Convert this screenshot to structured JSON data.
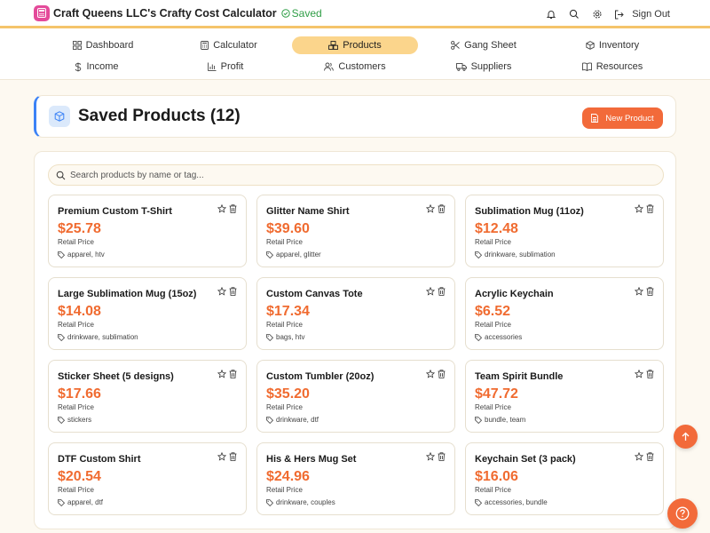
{
  "app": {
    "title": "Craft Queens LLC's Crafty Cost Calculator",
    "saved_label": "Saved",
    "sign_out_label": "Sign Out"
  },
  "colors": {
    "accent": "#f26a3a",
    "price": "#f06b30",
    "saved_green": "#2f9e46",
    "nav_active": "#fbd58c",
    "header_border": "#3b82f6"
  },
  "icons": {
    "logo": "calculator-icon",
    "saved": "check-circle-icon",
    "notifications": "bell-icon",
    "search": "search-icon",
    "settings": "gear-icon",
    "sign_out": "logout-icon"
  },
  "nav": {
    "row1": [
      {
        "label": "Dashboard",
        "icon": "grid-icon",
        "active": false
      },
      {
        "label": "Calculator",
        "icon": "calculator-icon",
        "active": false
      },
      {
        "label": "Products",
        "icon": "boxes-icon",
        "active": true
      },
      {
        "label": "Gang Sheet",
        "icon": "scissors-icon",
        "active": false
      },
      {
        "label": "Inventory",
        "icon": "package-icon",
        "active": false
      }
    ],
    "row2": [
      {
        "label": "Income",
        "icon": "dollar-icon",
        "active": false
      },
      {
        "label": "Profit",
        "icon": "bar-chart-icon",
        "active": false
      },
      {
        "label": "Customers",
        "icon": "users-icon",
        "active": false
      },
      {
        "label": "Suppliers",
        "icon": "truck-icon",
        "active": false
      },
      {
        "label": "Resources",
        "icon": "book-icon",
        "active": false
      }
    ]
  },
  "header": {
    "title": "Saved Products (12)",
    "new_product_label": "New Product"
  },
  "search": {
    "placeholder": "Search products by name or tag..."
  },
  "products": [
    {
      "name": "Premium Custom T-Shirt",
      "price": "$25.78",
      "price_label": "Retail Price",
      "tags": "apparel, htv"
    },
    {
      "name": "Glitter Name Shirt",
      "price": "$39.60",
      "price_label": "Retail Price",
      "tags": "apparel, glitter"
    },
    {
      "name": "Sublimation Mug (11oz)",
      "price": "$12.48",
      "price_label": "Retail Price",
      "tags": "drinkware, sublimation"
    },
    {
      "name": "Large Sublimation Mug (15oz)",
      "price": "$14.08",
      "price_label": "Retail Price",
      "tags": "drinkware, sublimation"
    },
    {
      "name": "Custom Canvas Tote",
      "price": "$17.34",
      "price_label": "Retail Price",
      "tags": "bags, htv"
    },
    {
      "name": "Acrylic Keychain",
      "price": "$6.52",
      "price_label": "Retail Price",
      "tags": "accessories"
    },
    {
      "name": "Sticker Sheet (5 designs)",
      "price": "$17.66",
      "price_label": "Retail Price",
      "tags": "stickers"
    },
    {
      "name": "Custom Tumbler (20oz)",
      "price": "$35.20",
      "price_label": "Retail Price",
      "tags": "drinkware, dtf"
    },
    {
      "name": "Team Spirit Bundle",
      "price": "$47.72",
      "price_label": "Retail Price",
      "tags": "bundle, team"
    },
    {
      "name": "DTF Custom Shirt",
      "price": "$20.54",
      "price_label": "Retail Price",
      "tags": "apparel, dtf"
    },
    {
      "name": "His & Hers Mug Set",
      "price": "$24.96",
      "price_label": "Retail Price",
      "tags": "drinkware, couples"
    },
    {
      "name": "Keychain Set (3 pack)",
      "price": "$16.06",
      "price_label": "Retail Price",
      "tags": "accessories, bundle"
    }
  ]
}
